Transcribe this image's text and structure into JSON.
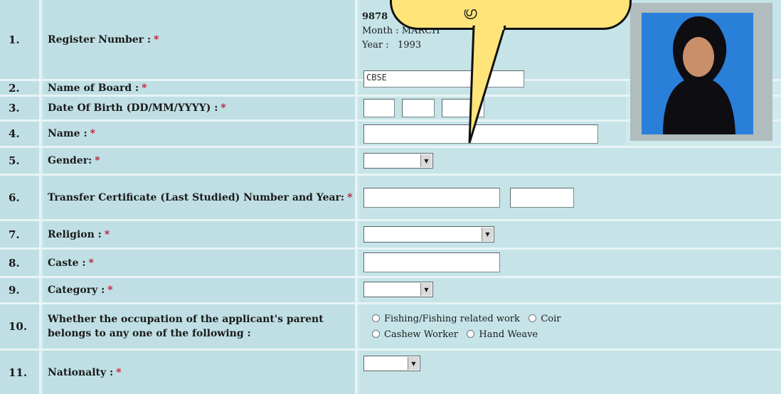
{
  "rows": [
    {
      "num": "1.",
      "label": "Register Number :"
    },
    {
      "num": "2.",
      "label": "Name of Board :"
    },
    {
      "num": "3.",
      "label": "Date Of Birth (DD/MM/YYYY) :"
    },
    {
      "num": "4.",
      "label": "Name :"
    },
    {
      "num": "5.",
      "label": "Gender:"
    },
    {
      "num": "6.",
      "label": "Transfer Certificate (Last Studied) Number and Year:"
    },
    {
      "num": "7.",
      "label": "Religion :"
    },
    {
      "num": "8.",
      "label": "Caste :"
    },
    {
      "num": "9.",
      "label": "Category :"
    },
    {
      "num": "10.",
      "label": "Whether the occupation of the applicant's parent belongs to any one of the following :"
    },
    {
      "num": "11.",
      "label": "Nationalty :"
    }
  ],
  "required_mark": "*",
  "register": {
    "number_partial": "9878",
    "month_label": "Month : MARCH",
    "year_label": "Year :",
    "year_value": "1993"
  },
  "board": {
    "value": "CBSE"
  },
  "occupation_options": [
    "Fishing/Fishing related work",
    "Coir",
    "Cashew Worker",
    "Hand Weave"
  ],
  "bubble_text": "ഗ്ര"
}
